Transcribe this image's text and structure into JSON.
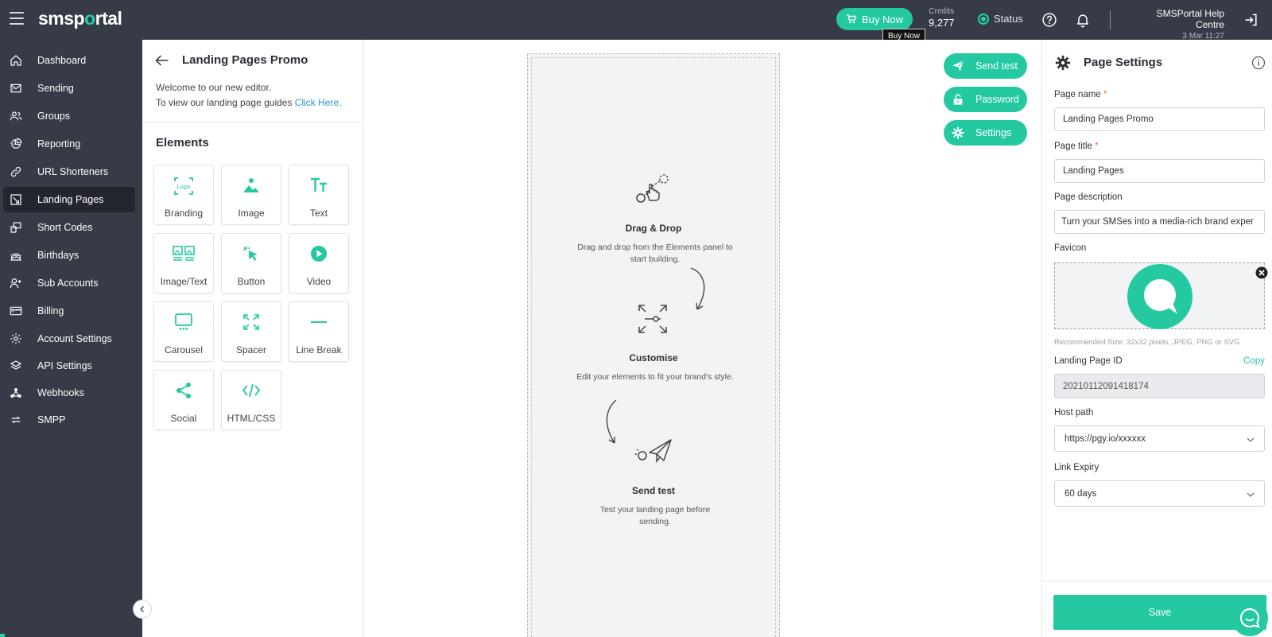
{
  "header": {
    "logo_main": "smsp",
    "logo_dot": "o",
    "logo_rest": "rtal",
    "buy_now_label": "Buy Now",
    "tooltip": "Buy Now",
    "credits_label": "Credits",
    "credits_value": "9,277",
    "status_label": "Status",
    "help_centre": "SMSPortal Help Centre",
    "datetime": "3 Mar 11:27"
  },
  "sidebar": {
    "items": [
      {
        "label": "Dashboard",
        "icon": "home-icon"
      },
      {
        "label": "Sending",
        "icon": "envelope-icon"
      },
      {
        "label": "Groups",
        "icon": "users-icon"
      },
      {
        "label": "Reporting",
        "icon": "pie-chart-icon"
      },
      {
        "label": "URL Shorteners",
        "icon": "link-icon"
      },
      {
        "label": "Landing Pages",
        "icon": "landing-page-icon"
      },
      {
        "label": "Short Codes",
        "icon": "short-codes-icon"
      },
      {
        "label": "Birthdays",
        "icon": "cake-icon"
      },
      {
        "label": "Sub Accounts",
        "icon": "user-plus-icon"
      },
      {
        "label": "Billing",
        "icon": "credit-card-icon"
      },
      {
        "label": "Account Settings",
        "icon": "gear-icon"
      },
      {
        "label": "API Settings",
        "icon": "layers-icon"
      },
      {
        "label": "Webhooks",
        "icon": "webhook-icon"
      },
      {
        "label": "SMPP",
        "icon": "sync-icon"
      }
    ]
  },
  "elements_panel": {
    "title": "Landing Pages Promo",
    "welcome_line1": "Welcome to our new editor.",
    "welcome_line2": "To view our landing page guides",
    "guide_link": "Click Here.",
    "elements_heading": "Elements",
    "logo_glyph_text": "Logo",
    "tiles": [
      "Branding",
      "Image",
      "Text",
      "Image/Text",
      "Button",
      "Video",
      "Carousel",
      "Spacer",
      "Line Break",
      "Social",
      "HTML/CSS"
    ]
  },
  "canvas": {
    "steps": [
      {
        "title": "Drag & Drop",
        "desc": "Drag and drop from the Elements panel to start building."
      },
      {
        "title": "Customise",
        "desc": "Edit your elements to fit your brand's style."
      },
      {
        "title": "Send test",
        "desc": "Test your landing page before sending."
      }
    ],
    "actions": {
      "send_test": "Send test",
      "password": "Password",
      "settings": "Settings"
    }
  },
  "settings": {
    "title": "Page Settings",
    "page_name_label": "Page name",
    "page_name_value": "Landing Pages Promo",
    "page_title_label": "Page title",
    "page_title_value": "Landing Pages",
    "page_description_label": "Page description",
    "page_description_value": "Turn your SMSes into a media-rich brand exper",
    "favicon_label": "Favicon",
    "recommended_size": "Recommended Size: 32x32 pixels, JPEG, PNG or SVG",
    "landing_page_id_label": "Landing Page ID",
    "copy_label": "Copy",
    "landing_page_id_value": "20210112091418174",
    "host_path_label": "Host path",
    "host_path_value": "https://pgy.io/xxxxxx",
    "link_expiry_label": "Link Expiry",
    "link_expiry_value": "60 days",
    "required_marker": "*",
    "save_label": "Save"
  },
  "colors": {
    "accent": "#24c9a2",
    "topbar": "#373a47",
    "sidebar_active": "#24262f"
  }
}
